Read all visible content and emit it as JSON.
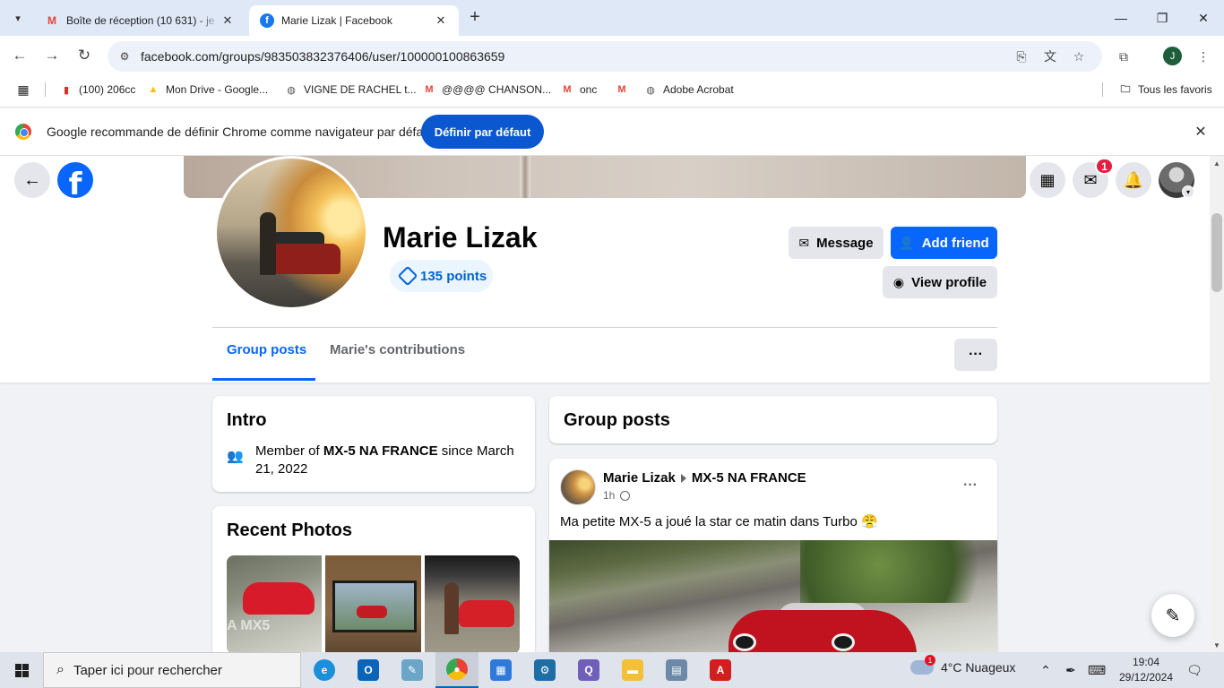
{
  "browser": {
    "tabs": [
      {
        "title": "Boîte de réception (10 631) - je",
        "icon": "gmail-icon"
      },
      {
        "title": "Marie Lizak | Facebook",
        "icon": "facebook-icon"
      }
    ],
    "url": "facebook.com/groups/983503832376406/user/100000100863659",
    "profile_initial": "J",
    "bookmarks": [
      {
        "label": "(100) 206cc",
        "icon": "bookmark-icon"
      },
      {
        "label": "Mon Drive - Google...",
        "icon": "drive-icon"
      },
      {
        "label": "VIGNE DE RACHEL t...",
        "icon": "globe-icon"
      },
      {
        "label": "@@@@ CHANSON...",
        "icon": "gmail-icon"
      },
      {
        "label": "onc",
        "icon": "gmail-icon"
      },
      {
        "label": "",
        "icon": "gmail-icon"
      },
      {
        "label": "Adobe Acrobat",
        "icon": "globe-icon"
      }
    ],
    "all_bookmarks": "Tous les favoris",
    "infobar": {
      "text": "Google recommande de définir Chrome comme navigateur par défaut",
      "button": "Définir par défaut"
    }
  },
  "facebook": {
    "messenger_badge": "1",
    "profile": {
      "name": "Marie Lizak",
      "points": "135 points",
      "message_button": "Message",
      "add_friend_button": "Add friend",
      "view_profile_button": "View profile",
      "more_button": "···"
    },
    "tabs": [
      {
        "label": "Group posts",
        "active": true
      },
      {
        "label": "Marie's contributions",
        "active": false
      }
    ],
    "intro": {
      "title": "Intro",
      "member_prefix": "Member of ",
      "group_name": "MX-5 NA FRANCE",
      "member_suffix": " since March 21, 2022"
    },
    "recent_photos": {
      "title": "Recent Photos",
      "photo1_watermark": "A MX5"
    },
    "group_posts": {
      "title": "Group posts",
      "post": {
        "author": "Marie Lizak",
        "group": "MX-5 NA FRANCE",
        "time": "1h",
        "text": "Ma petite MX-5 a joué la star ce matin dans Turbo 😤",
        "more": "···"
      }
    }
  },
  "taskbar": {
    "search_placeholder": "Taper ici pour rechercher",
    "weather": "4°C  Nuageux",
    "weather_badge": "1",
    "time": "19:04",
    "date": "29/12/2024"
  }
}
